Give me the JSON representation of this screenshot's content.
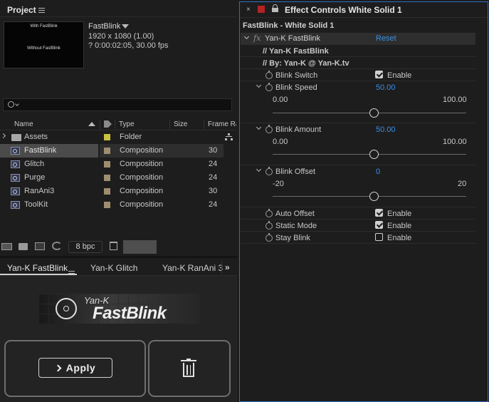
{
  "project_panel": {
    "title": "Project",
    "comp_name": "FastBlink",
    "comp_res": "1920 x 1080 (1.00)",
    "comp_dur": "? 0:00:02:05, 30.00 fps",
    "thumb_top_text": "With FastBlink",
    "thumb_bottom_text": "Without FastBlink",
    "search_placeholder": "",
    "columns": {
      "name": "Name",
      "type": "Type",
      "size": "Size",
      "frame_rate": "Frame Ra"
    },
    "items": [
      {
        "name": "Assets",
        "type": "Folder",
        "value": "",
        "label_color": "#c9c241",
        "icon": "folder-icon"
      },
      {
        "name": "FastBlink",
        "type": "Composition",
        "value": "30",
        "label_color": "#9e8e6f",
        "icon": "composition-icon"
      },
      {
        "name": "Glitch",
        "type": "Composition",
        "value": "24",
        "label_color": "#9e8e6f",
        "icon": "composition-icon"
      },
      {
        "name": "Purge",
        "type": "Composition",
        "value": "24",
        "label_color": "#9e8e6f",
        "icon": "composition-icon"
      },
      {
        "name": "RanAni3",
        "type": "Composition",
        "value": "30",
        "label_color": "#9e8e6f",
        "icon": "composition-icon"
      },
      {
        "name": "ToolKit",
        "type": "Composition",
        "value": "24",
        "label_color": "#9e8e6f",
        "icon": "composition-icon"
      }
    ],
    "bpc": "8 bpc"
  },
  "plugin_panel": {
    "tabs": [
      "Yan-K FastBlink",
      "Yan-K Glitch",
      "Yan-K RanAni 3"
    ],
    "logo_small": "Yan-K",
    "logo_big": "FastBlink",
    "apply_label": "Apply"
  },
  "effect_controls": {
    "title": "Effect Controls White Solid 1",
    "layer_path": "FastBlink - White Solid 1",
    "effect_name": "Yan-K FastBlink",
    "reset_label": "Reset",
    "comment1": "// Yan-K FastBlink",
    "comment2": "// By: Yan-K @ Yan-K.tv",
    "blink_switch": {
      "label": "Blink Switch",
      "checkbox": "Enable",
      "checked": true
    },
    "blink_speed": {
      "label": "Blink Speed",
      "value": "50.00",
      "min": "0.00",
      "max": "100.00",
      "level": 0.5
    },
    "blink_amount": {
      "label": "Blink Amount",
      "value": "50.00",
      "min": "0.00",
      "max": "100.00",
      "level": 0.5
    },
    "blink_offset": {
      "label": "Blink Offset",
      "value": "0",
      "min": "-20",
      "max": "20",
      "level": 0.5
    },
    "auto_offset": {
      "label": "Auto Offset",
      "checkbox": "Enable",
      "checked": true
    },
    "static_mode": {
      "label": "Static Mode",
      "checkbox": "Enable",
      "checked": true
    },
    "stay_blink": {
      "label": "Stay Blink",
      "checkbox": "Enable",
      "checked": false
    }
  },
  "colors": {
    "accent_blue": "#3b8fe6",
    "selection": "#4b4b4b",
    "panel_border": "#2d6dc5",
    "red_swatch": "#b42323"
  }
}
